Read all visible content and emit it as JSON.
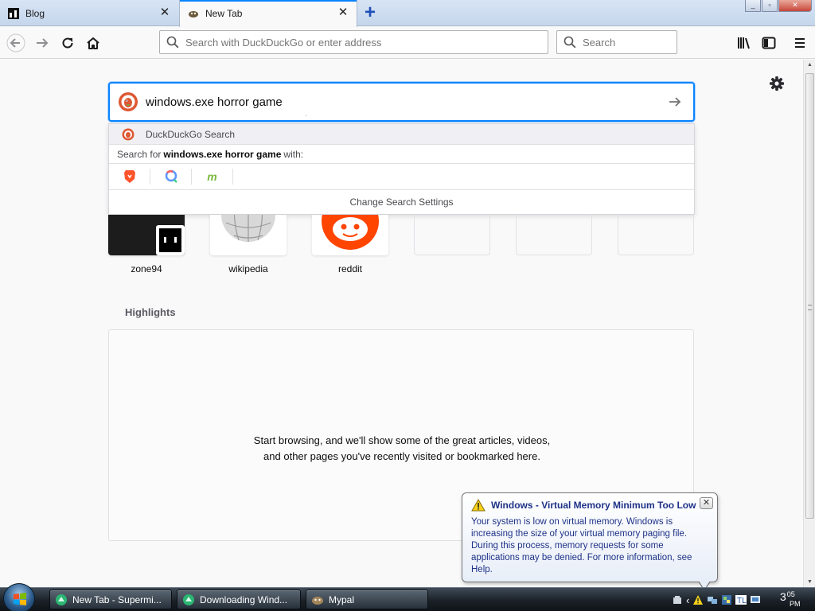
{
  "tabs": [
    {
      "title": "Blog",
      "icon": "blog-favicon"
    },
    {
      "title": "New Tab",
      "icon": "ddg-favicon"
    }
  ],
  "nav": {
    "url_placeholder": "Search with DuckDuckGo or enter address",
    "search_placeholder": "Search"
  },
  "newtab": {
    "query": "windows.exe horror game",
    "dropdown": {
      "engine_label": "DuckDuckGo Search",
      "search_for_prefix": "Search for",
      "search_for_query": "windows.exe horror game",
      "search_for_suffix": "with:",
      "engines": [
        "brave-icon",
        "qwant-icon",
        "mojeek-icon"
      ],
      "settings_label": "Change Search Settings"
    },
    "top_sites": [
      {
        "label": "zone94"
      },
      {
        "label": "wikipedia"
      },
      {
        "label": "reddit"
      },
      {
        "label": ""
      },
      {
        "label": ""
      },
      {
        "label": ""
      }
    ],
    "highlights": {
      "title": "Highlights",
      "empty_message": "Start browsing, and we'll show some of the great articles, videos, and other pages you've recently visited or bookmarked here."
    }
  },
  "balloon": {
    "title": "Windows - Virtual Memory Minimum Too Low",
    "body": "Your system is low on virtual memory. Windows is increasing the size of your virtual memory paging file. During this process, memory requests for some applications may be denied. For more information, see Help."
  },
  "taskbar": {
    "buttons": [
      {
        "label": "New Tab - Supermi..."
      },
      {
        "label": "Downloading Wind..."
      },
      {
        "label": "Mypal"
      }
    ],
    "clock_hour": "3",
    "clock_min": "05",
    "clock_ampm": "PM"
  },
  "colors": {
    "accent": "#0a84ff",
    "reddit": "#ff4500",
    "ddg": "#de5833"
  }
}
